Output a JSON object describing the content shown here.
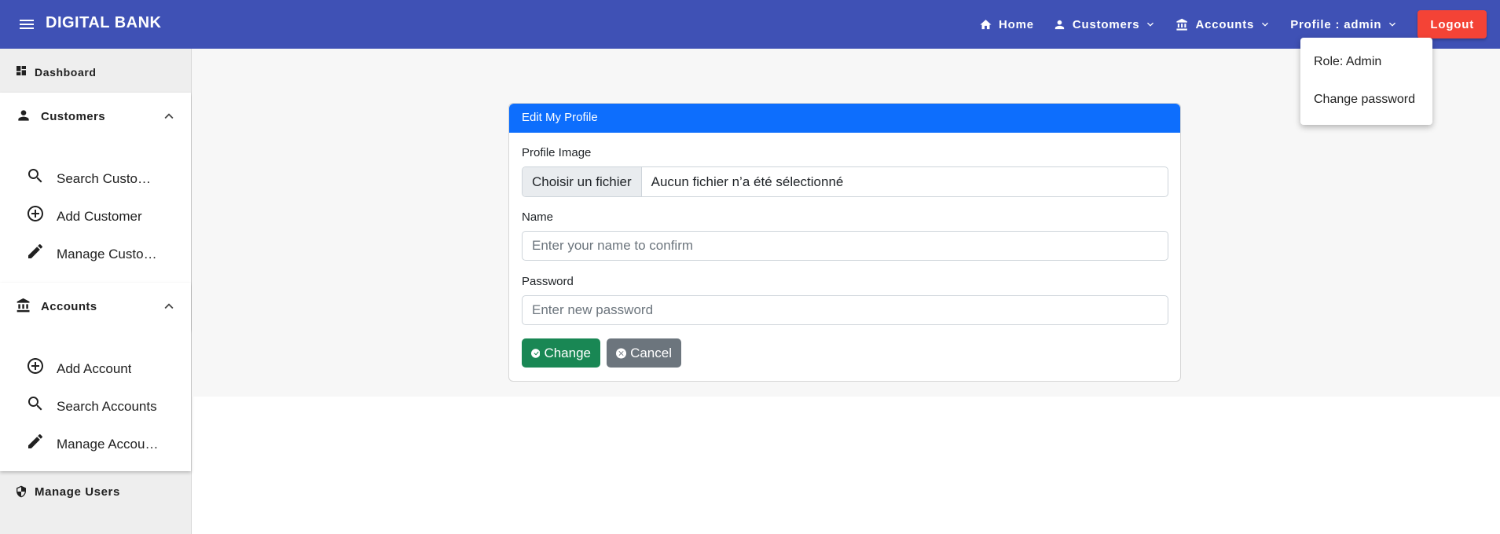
{
  "app": {
    "title": "DIGITAL BANK"
  },
  "nav": {
    "home": "Home",
    "customers": "Customers",
    "accounts": "Accounts",
    "profile": "Profile : admin",
    "logout": "Logout"
  },
  "profile_menu": {
    "role": "Role: Admin",
    "change_password": "Change password"
  },
  "sidebar": {
    "dashboard": "Dashboard",
    "customers": {
      "label": "Customers",
      "items": [
        {
          "label": "Search Customers",
          "icon": "search-icon"
        },
        {
          "label": "Add Customer",
          "icon": "add-circle-icon"
        },
        {
          "label": "Manage Customers",
          "icon": "edit-icon"
        }
      ]
    },
    "accounts": {
      "label": "Accounts",
      "items": [
        {
          "label": "Add Account",
          "icon": "add-circle-icon"
        },
        {
          "label": "Search Accounts",
          "icon": "search-icon"
        },
        {
          "label": "Manage Accounts",
          "icon": "edit-icon"
        }
      ]
    },
    "manage_users": "Manage Users"
  },
  "form": {
    "title": "Edit My Profile",
    "profile_image_label": "Profile Image",
    "file_button": "Choisir un fichier",
    "file_status": "Aucun fichier n’a été sélectionné",
    "name_label": "Name",
    "name_placeholder": "Enter your name to confirm",
    "password_label": "Password",
    "password_placeholder": "Enter new password",
    "change_button": "Change",
    "cancel_button": "Cancel"
  },
  "colors": {
    "toolbar": "#3f51b5",
    "logout": "#f44336",
    "card_header": "#0d6efd",
    "change_button": "#198754",
    "cancel_button": "#6c757d"
  }
}
